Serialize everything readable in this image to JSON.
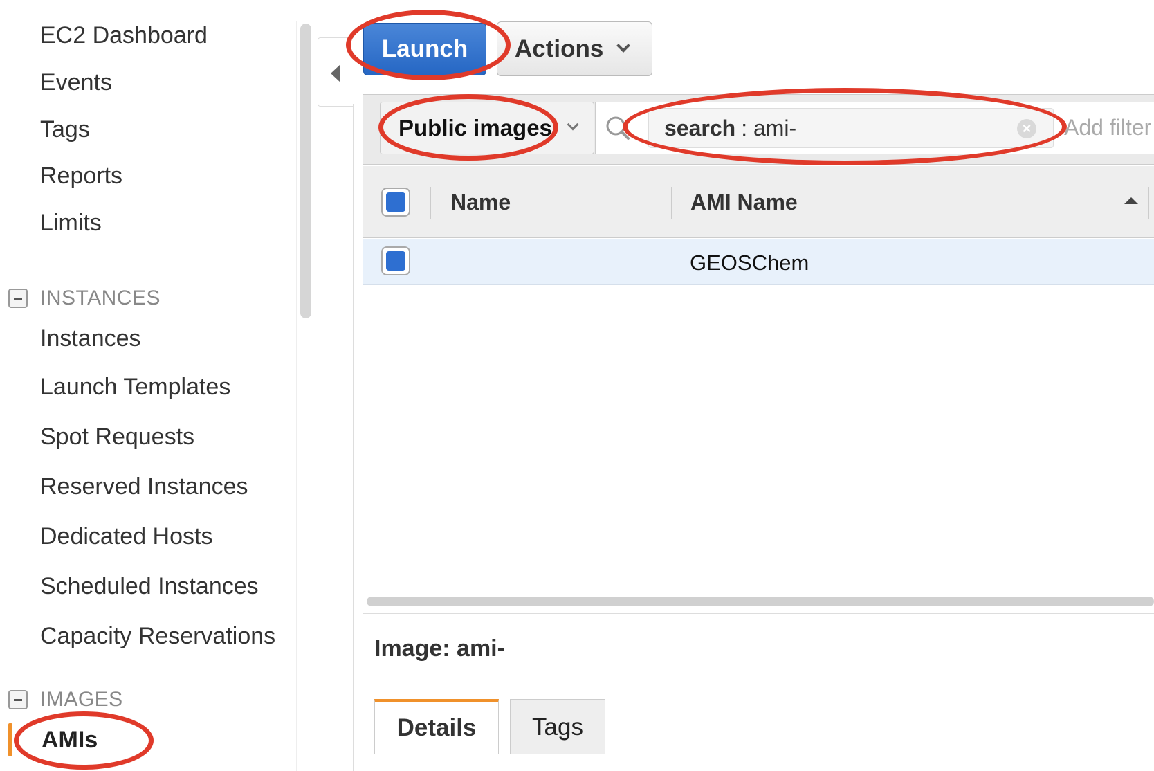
{
  "sidebar": {
    "items": [
      {
        "label": "EC2 Dashboard"
      },
      {
        "label": "Events"
      },
      {
        "label": "Tags"
      },
      {
        "label": "Reports"
      },
      {
        "label": "Limits"
      }
    ],
    "sections": [
      {
        "header": "INSTANCES",
        "items": [
          {
            "label": "Instances"
          },
          {
            "label": "Launch Templates"
          },
          {
            "label": "Spot Requests"
          },
          {
            "label": "Reserved Instances"
          },
          {
            "label": "Dedicated Hosts"
          },
          {
            "label": "Scheduled Instances"
          },
          {
            "label": "Capacity Reservations"
          }
        ]
      },
      {
        "header": "IMAGES",
        "items": [
          {
            "label": "AMIs",
            "active": true
          }
        ]
      }
    ]
  },
  "toolbar": {
    "launch_label": "Launch",
    "actions_label": "Actions"
  },
  "filter": {
    "scope_label": "Public images",
    "token_key": "search",
    "token_value": ": ami-",
    "add_filter_placeholder": "Add filter"
  },
  "table": {
    "columns": [
      "Name",
      "AMI Name"
    ],
    "rows": [
      {
        "name": "",
        "ami_name": "GEOSChem"
      }
    ]
  },
  "details": {
    "image_label": "Image: ami-",
    "tabs": [
      {
        "label": "Details",
        "active": true
      },
      {
        "label": "Tags",
        "active": false
      }
    ]
  },
  "colors": {
    "primary_button": "#2667c4",
    "active_accent": "#f0912b",
    "annotation": "#e03a2a",
    "selected_row": "#e8f1fb"
  }
}
